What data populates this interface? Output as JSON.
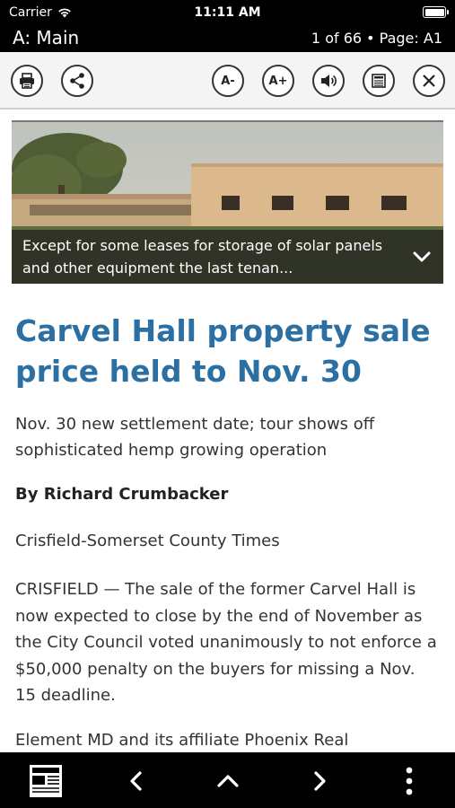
{
  "status_bar": {
    "carrier": "Carrier",
    "time": "11:11 AM",
    "battery_level": 1.0
  },
  "title_bar": {
    "section": "A: Main",
    "page_info": "1 of 66 • Page: A1"
  },
  "toolbar": {
    "print_icon": "printer-icon",
    "share_icon": "share-icon",
    "decrease_font_label": "A-",
    "increase_font_label": "A+",
    "audio_icon": "speaker-icon",
    "text_view_icon": "article-text-icon",
    "close_icon": "close-icon"
  },
  "article": {
    "photo_caption": "Except for some leases for storage of solar panels and other equipment the last tenan...",
    "headline": "Carvel Hall property sale price held to Nov. 30",
    "subhead": "Nov. 30 new settlement date; tour shows off sophisticated hemp growing operation",
    "byline": "By Richard Crumbacker",
    "source": "Crisfield-Somerset County Times",
    "paragraph_1": "CRISFIELD — The sale of the former Carvel Hall is now expected to close by the end of November as the City Council voted unanimously to not enforce a $50,000 penalty on the buyers for missing a Nov. 15 deadline.",
    "paragraph_2": "Element MD and its affiliate Phoenix Real"
  },
  "bottom_nav": {
    "pages_icon": "newspaper-pages-icon",
    "prev_icon": "chevron-left-icon",
    "up_icon": "chevron-up-icon",
    "next_icon": "chevron-right-icon",
    "more_icon": "more-vertical-icon"
  },
  "colors": {
    "headline": "#2b6fa3",
    "bars": "#000000",
    "toolbar_bg": "#f4f4f4"
  }
}
